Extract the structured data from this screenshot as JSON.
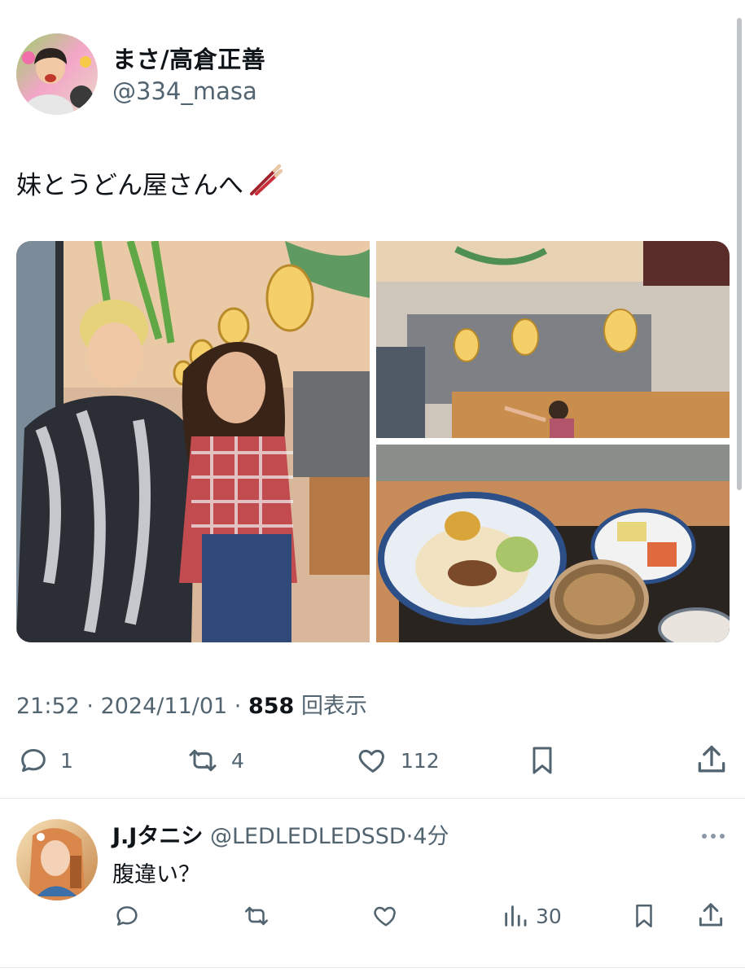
{
  "tweet": {
    "display_name": "まさ/高倉正善",
    "handle": "@334_masa",
    "text": "妹とうどん屋さんへ",
    "emoji_icon": "chopsticks-icon",
    "time": "21:52",
    "date": "2024/11/01",
    "views_count": "858",
    "views_label": "回表示",
    "actions": {
      "reply_count": "1",
      "retweet_count": "4",
      "like_count": "112"
    }
  },
  "reply": {
    "display_name": "J.Jタニシ",
    "handle": "@LEDLEDLEDSSD",
    "time_ago": "4分",
    "text": "腹違い？",
    "actions": {
      "views_count": "30"
    }
  },
  "colors": {
    "text": "#0f1419",
    "secondary": "#536471",
    "divider": "#e6ecf0"
  }
}
